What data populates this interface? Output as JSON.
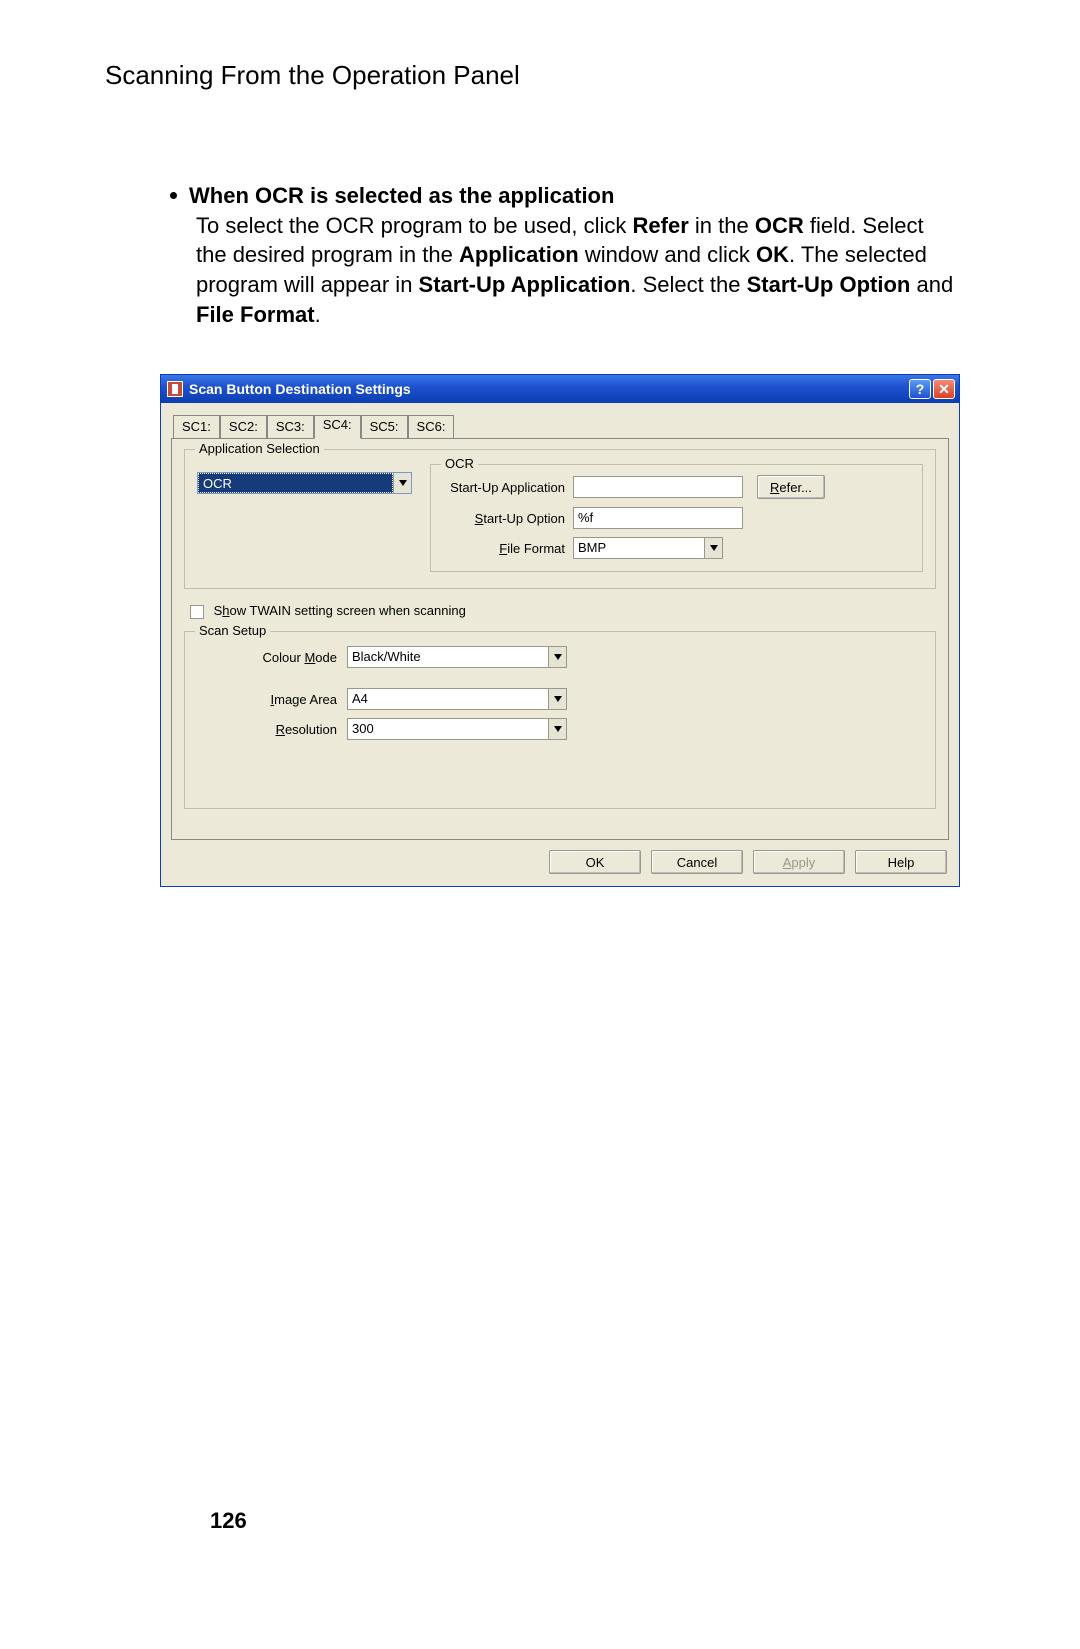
{
  "page": {
    "header": "Scanning From the Operation Panel",
    "bullet_heading": "When OCR is selected as the application",
    "desc_prefix": "To select the OCR program to be used, click ",
    "desc_refer": "Refer",
    "desc_mid1": " in the ",
    "desc_ocr": "OCR",
    "desc_mid2": " field. Select the desired program in the ",
    "desc_app": "Application",
    "desc_mid3": " window and click ",
    "desc_ok": "OK",
    "desc_mid4": ". The selected program will appear in ",
    "desc_sua": "Start-Up Application",
    "desc_mid5": ". Select the ",
    "desc_suo": "Start-Up Option",
    "desc_mid6": " and ",
    "desc_ff": "File Format",
    "desc_end": ".",
    "page_number": "126"
  },
  "dialog": {
    "title": "Scan Button Destination Settings",
    "help_icon": "?",
    "close_icon": "✕",
    "tabs": [
      {
        "label": "SC1:"
      },
      {
        "label": "SC2:"
      },
      {
        "label": "SC3:"
      },
      {
        "label": "SC4:"
      },
      {
        "label": "SC5:"
      },
      {
        "label": "SC6:"
      }
    ],
    "active_tab_index": 3,
    "app_selection": {
      "legend": "Application Selection",
      "selected": "OCR",
      "ocr_legend": "OCR",
      "startup_app_label": "Start-Up Application",
      "startup_app_value": "",
      "refer_label": "Refer...",
      "refer_key": "R",
      "startup_opt_label_pre": "",
      "startup_opt_label": "Start-Up Option",
      "startup_opt_key": "S",
      "startup_opt_value": "%f",
      "file_format_label": "File Format",
      "file_format_key": "F",
      "file_format_value": "BMP"
    },
    "twain_checkbox_label": "Show TWAIN setting screen when scanning",
    "twain_key": "h",
    "scan_setup": {
      "legend": "Scan Setup",
      "colour_mode_label": "Colour Mode",
      "colour_mode_key": "M",
      "colour_mode_value": "Black/White",
      "image_area_label": "Image Area",
      "image_area_key": "I",
      "image_area_value": "A4",
      "resolution_label": "Resolution",
      "resolution_key": "R",
      "resolution_value": "300"
    },
    "buttons": {
      "ok": "OK",
      "cancel": "Cancel",
      "apply": "Apply",
      "apply_key": "A",
      "help": "Help"
    }
  }
}
